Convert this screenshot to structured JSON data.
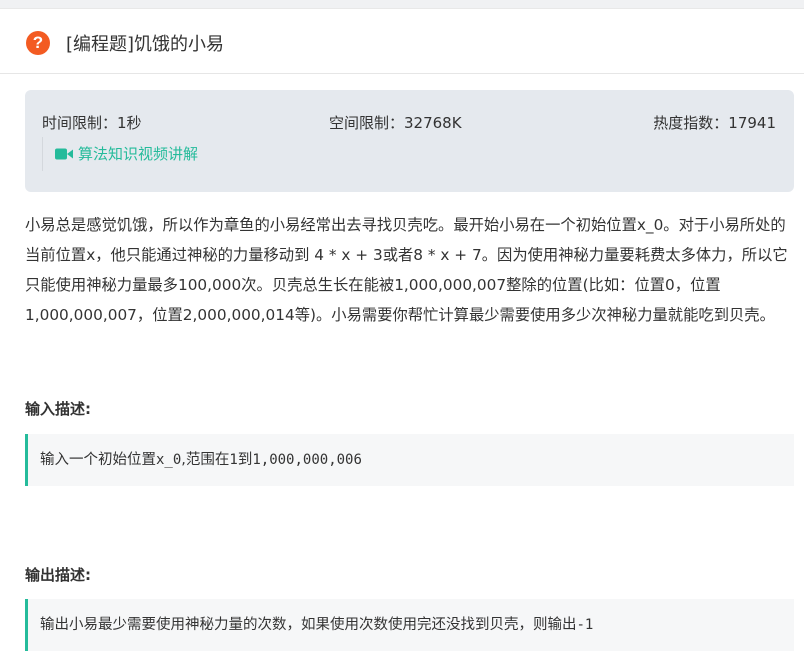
{
  "header": {
    "title": "[编程题]饥饿的小易",
    "icon": "question-icon"
  },
  "info": {
    "time_limit": "时间限制：1秒",
    "memory_limit": "空间限制：32768K",
    "heat_index": "热度指数：17941",
    "video_link": "算法知识视频讲解"
  },
  "description": "小易总是感觉饥饿，所以作为章鱼的小易经常出去寻找贝壳吃。最开始小易在一个初始位置x_0。对于小易所处的当前位置x，他只能通过神秘的力量移动到 4 * x + 3或者8 * x + 7。因为使用神秘力量要耗费太多体力，所以它只能使用神秘力量最多100,000次。贝壳总生长在能被1,000,000,007整除的位置(比如：位置0，位置1,000,000,007，位置2,000,000,014等)。小易需要你帮忙计算最少需要使用多少次神秘力量就能吃到贝壳。",
  "input": {
    "heading": "输入描述:",
    "text_prefix": "输入一个初始位置",
    "code_var": "x_0",
    "text_mid": ",范围在",
    "code_low": "1",
    "text_to": "到",
    "code_high": "1,000,000,006"
  },
  "output": {
    "heading": "输出描述:",
    "text": "输出小易最少需要使用神秘力量的次数，如果使用次数使用完还没找到贝壳，则输出",
    "code_value": "-1"
  },
  "colors": {
    "accent": "#25bb9b",
    "icon_orange": "#f35b22",
    "info_bg": "#e5e9ee"
  }
}
